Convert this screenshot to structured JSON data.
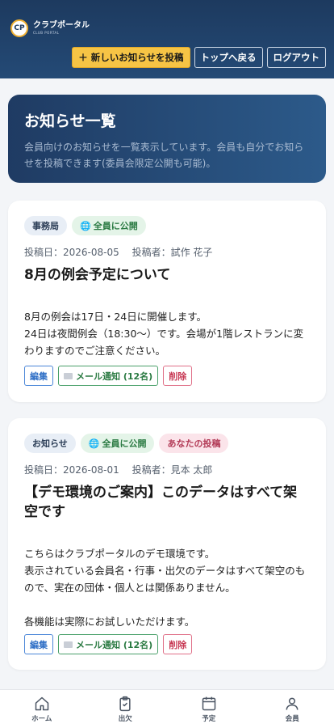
{
  "header": {
    "logo_mark": "CP",
    "brand_name": "クラブポータル",
    "brand_sub": "CLUB PORTAL",
    "post_button": "＋ 新しいお知らせを投稿",
    "top_button": "トップへ戻る",
    "logout_button": "ログアウト",
    "colors": {
      "bg": "#1d3a5f",
      "accent": "#f6c445"
    }
  },
  "hero": {
    "title": "お知らせ一覧",
    "description": "会員向けのお知らせを一覧表示しています。会員も自分でお知らせを投稿できます(委員会限定公開も可能)。"
  },
  "posts": [
    {
      "tags": [
        "事務局",
        "全員に公開"
      ],
      "date": "投稿日：2026-08-05",
      "author": "投稿者：試作 花子",
      "title": "8月の例会予定について",
      "body": "8月の例会は17日・24日に開催します。\n24日は夜間例会（18:30〜）です。会場が1階レストランに変わりますのでご注意ください。",
      "edit_label": "編集",
      "mail_label": "メール通知 (12名)",
      "delete_label": "削除"
    },
    {
      "tags": [
        "お知らせ",
        "全員に公開",
        "あなたの投稿"
      ],
      "date": "投稿日：2026-08-01",
      "author": "投稿者：見本 太郎",
      "title": "【デモ環境のご案内】このデータはすべて架空です",
      "body": "こちらはクラブポータルのデモ環境です。\n表示されている会員名・行事・出欠のデータはすべて架空のもので、実在の団体・個人とは関係ありません。\n\n各機能は実際にお試しいただけます。",
      "edit_label": "編集",
      "mail_label": "メール通知 (12名)",
      "delete_label": "削除"
    }
  ],
  "nav": {
    "items": [
      {
        "label": "ホーム",
        "icon": "home-icon"
      },
      {
        "label": "出欠",
        "icon": "clipboard-check-icon"
      },
      {
        "label": "予定",
        "icon": "calendar-icon"
      },
      {
        "label": "会員",
        "icon": "user-icon"
      }
    ]
  }
}
